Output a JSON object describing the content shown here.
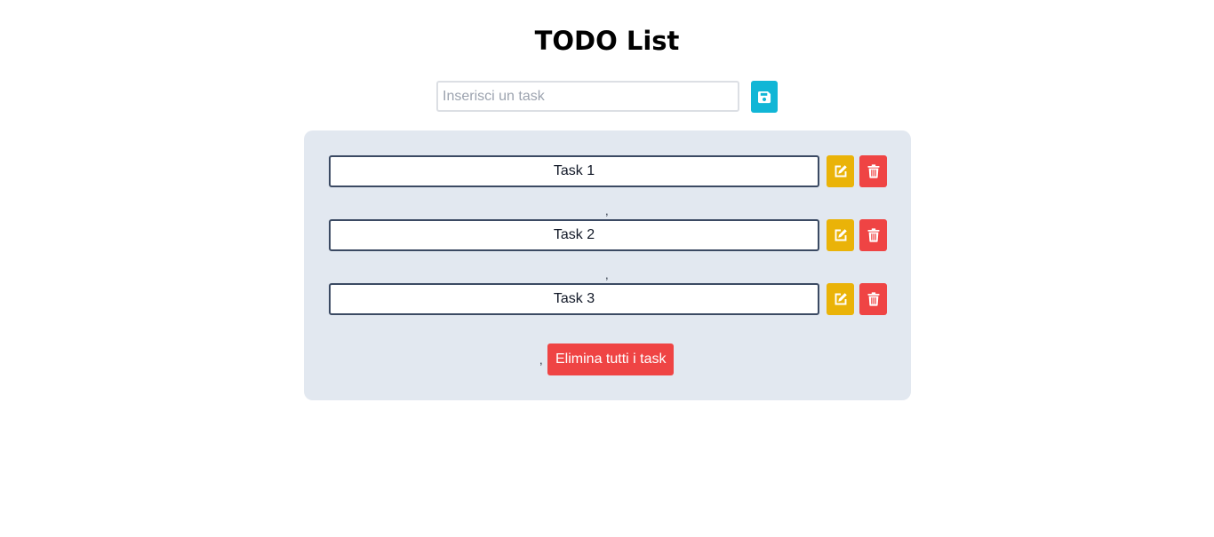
{
  "header": {
    "title": "TODO List"
  },
  "add_task": {
    "placeholder": "Inserisci un task",
    "value": "",
    "save_icon": "save-icon"
  },
  "tasks": [
    {
      "text": "Task 1",
      "edit_icon": "edit-icon",
      "delete_icon": "trash-icon"
    },
    {
      "text": "Task 2",
      "edit_icon": "edit-icon",
      "delete_icon": "trash-icon"
    },
    {
      "text": "Task 3",
      "edit_icon": "edit-icon",
      "delete_icon": "trash-icon"
    }
  ],
  "separators": [
    ",",
    ",",
    ","
  ],
  "footer": {
    "clear_all_label": "Elimina tutti i task"
  },
  "colors": {
    "panel_background": "#e2e8f0",
    "save_button": "#11b6d6",
    "edit_button": "#eab308",
    "delete_button": "#ef4444",
    "task_border": "#3b4a63"
  }
}
